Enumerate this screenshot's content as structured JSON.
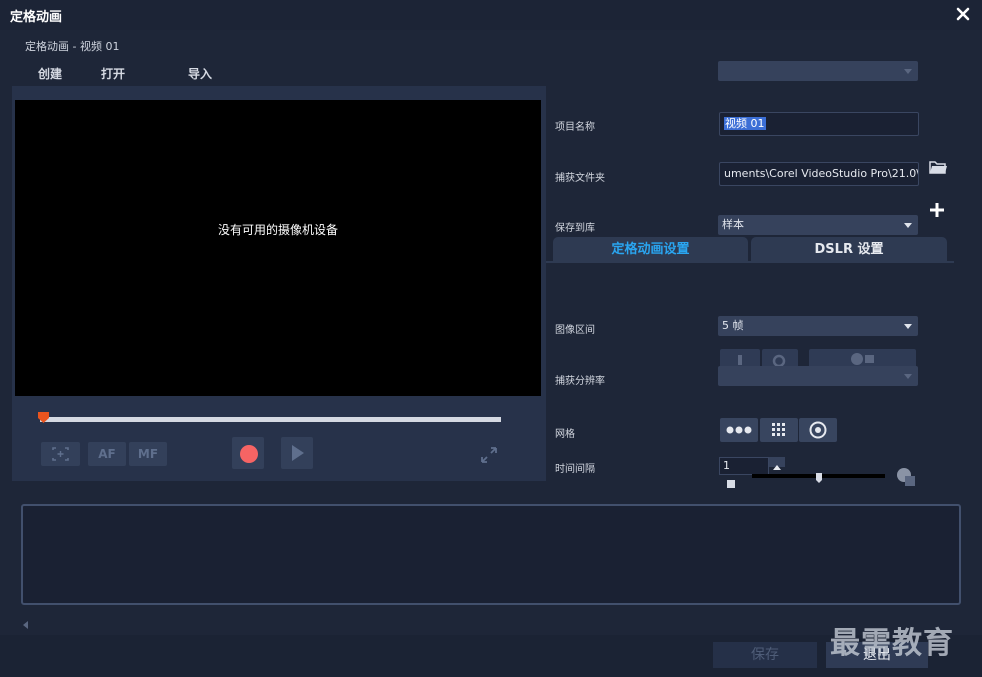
{
  "window": {
    "title": "定格动画",
    "subtitle": "定格动画 - 视频 01"
  },
  "menu": {
    "create": "创建",
    "open": "打开",
    "import": "导入"
  },
  "preview": {
    "message": "没有可用的摄像机设备"
  },
  "controls": {
    "af_label": "AF",
    "mf_label": "MF"
  },
  "settings": {
    "project_name_label": "项目名称",
    "project_name_value": "视频 01",
    "capture_folder_label": "捕获文件夹",
    "capture_folder_value": "uments\\Corel VideoStudio Pro\\21.0\\",
    "save_to_library_label": "保存到库",
    "save_to_library_value": "样本"
  },
  "tabs": {
    "stop_motion": "定格动画设置",
    "dslr": "DSLR 设置"
  },
  "stop_motion": {
    "image_duration_label": "图像区间",
    "image_duration_value": "5 帧",
    "capture_resolution_label": "捕获分辨率",
    "grid_label": "网格",
    "time_interval_label": "时间间隔",
    "time_interval_value": "1"
  },
  "footer": {
    "save": "保存",
    "exit": "退出"
  },
  "watermark": "最需教育",
  "colors": {
    "accent": "#2aa5f0",
    "record": "#f66464",
    "timeline_handle": "#e8541e"
  }
}
